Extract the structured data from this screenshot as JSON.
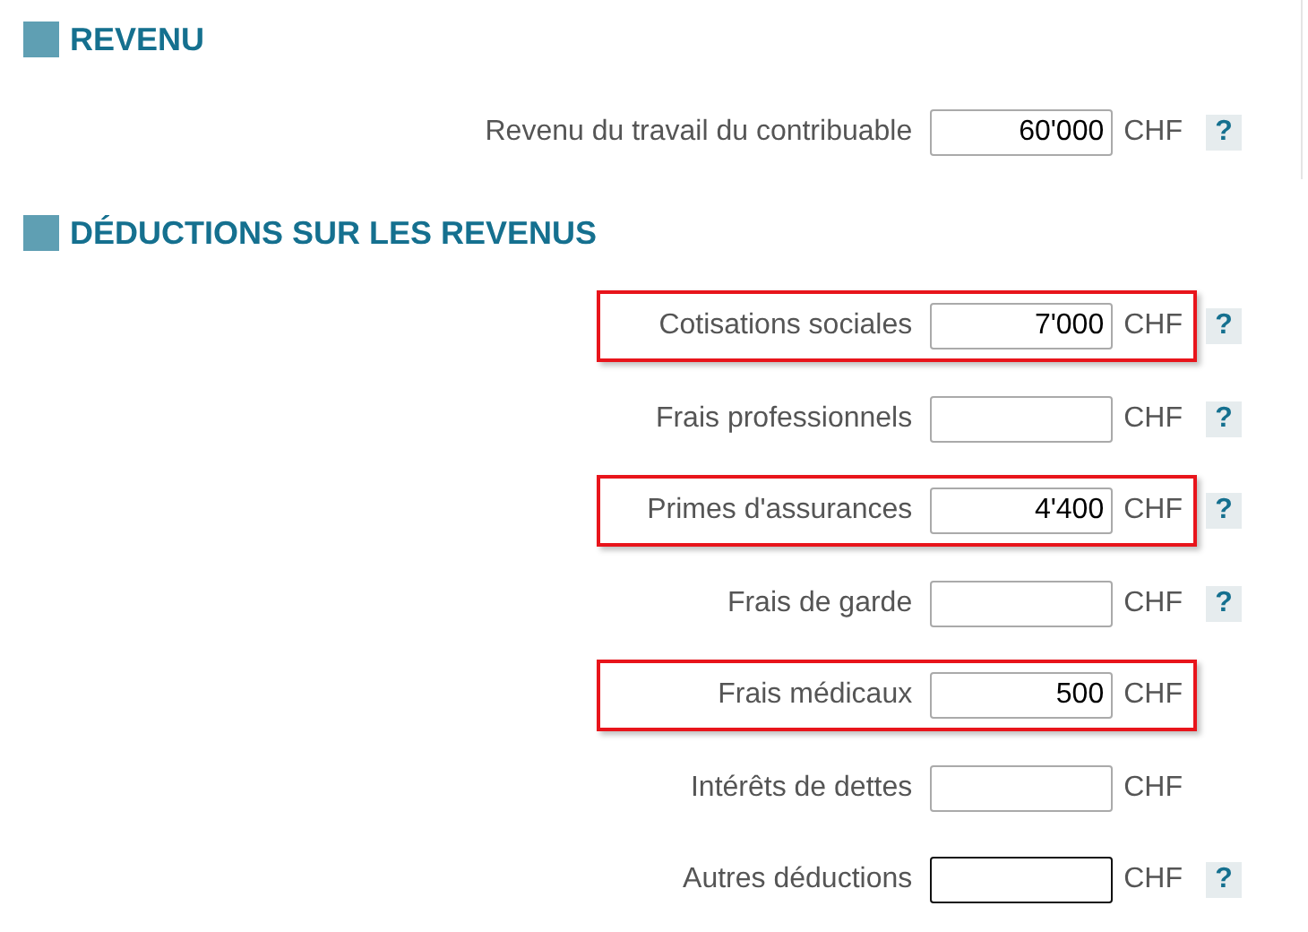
{
  "sections": [
    {
      "title": "REVENU",
      "rows": [
        {
          "label": "Revenu du travail du contribuable",
          "value": "60'000",
          "unit": "CHF",
          "help": "?",
          "highlighted": false,
          "focused": false
        }
      ]
    },
    {
      "title": "DÉDUCTIONS SUR LES REVENUS",
      "rows": [
        {
          "label": "Cotisations sociales",
          "value": "7'000",
          "unit": "CHF",
          "help": "?",
          "highlighted": true,
          "focused": false
        },
        {
          "label": "Frais professionnels",
          "unit": "CHF",
          "help": "?",
          "highlighted": false,
          "focused": false
        },
        {
          "label": "Primes d'assurances",
          "value": "4'400",
          "unit": "CHF",
          "help": "?",
          "highlighted": true,
          "focused": false
        },
        {
          "label": "Frais de garde",
          "unit": "CHF",
          "help": "?",
          "highlighted": false,
          "focused": false
        },
        {
          "label": "Frais médicaux",
          "value": "500",
          "unit": "CHF",
          "highlighted": true,
          "focused": false
        },
        {
          "label": "Intérêts de dettes",
          "unit": "CHF",
          "highlighted": false,
          "focused": false
        },
        {
          "label": "Autres déductions",
          "unit": "CHF",
          "help": "?",
          "highlighted": false,
          "focused": true
        }
      ]
    }
  ]
}
